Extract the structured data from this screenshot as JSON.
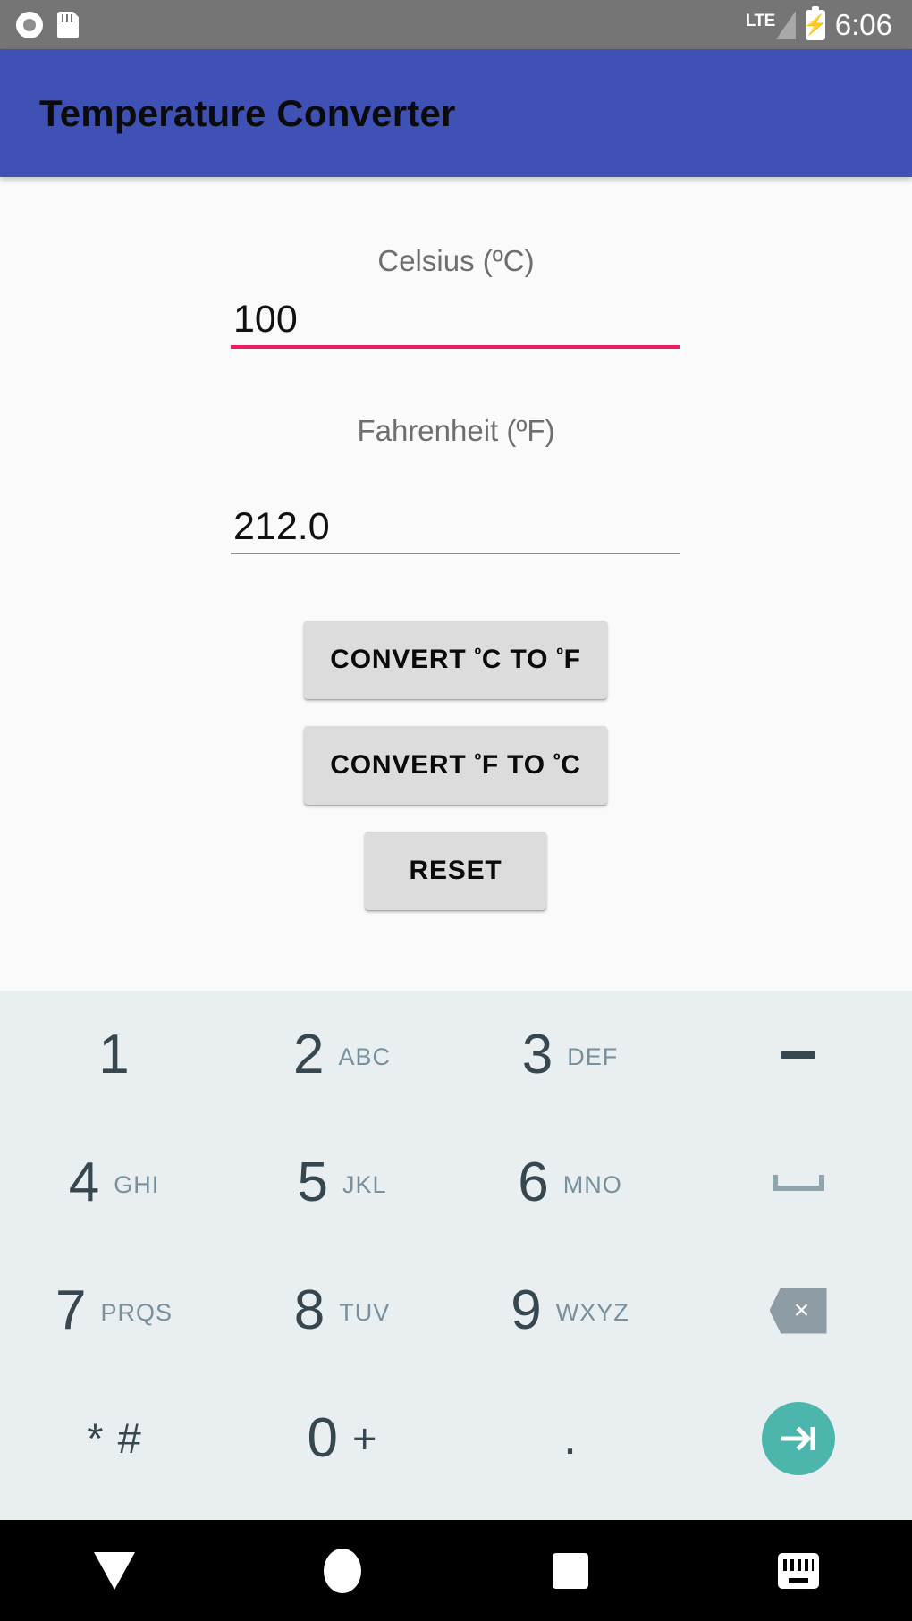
{
  "status_bar": {
    "icons": [
      "screen-record-icon",
      "sd-card-icon"
    ],
    "network": "LTE",
    "battery_state": "charging",
    "time": "6:06",
    "background_color": "#757575"
  },
  "app_bar": {
    "title": "Temperature Converter",
    "background_color": "#3F51B5"
  },
  "form": {
    "celsius": {
      "label": "Celsius (ºC)",
      "value": "100",
      "focused": true,
      "underline_color": "#E91E63"
    },
    "fahrenheit": {
      "label": "Fahrenheit (ºF)",
      "value": "212.0",
      "focused": false,
      "underline_color": "#8C8C8C"
    }
  },
  "buttons": {
    "c_to_f": {
      "prefix": "CONVERT ",
      "deg1": "º",
      "mid1": "C TO ",
      "deg2": "º",
      "mid2": "F"
    },
    "f_to_c": {
      "prefix": "CONVERT ",
      "deg1": "º",
      "mid1": "F TO ",
      "deg2": "º",
      "mid2": "C"
    },
    "reset": "RESET"
  },
  "keyboard": {
    "background_color": "#E9EEF1",
    "digit_color": "#37474F",
    "sub_color": "#78909C",
    "action_color": "#4DB6AC",
    "rows": [
      [
        {
          "digit": "1",
          "sub": "",
          "type": "digit"
        },
        {
          "digit": "2",
          "sub": "ABC",
          "type": "digit"
        },
        {
          "digit": "3",
          "sub": "DEF",
          "type": "digit"
        },
        {
          "digit": "",
          "sub": "",
          "type": "minus"
        }
      ],
      [
        {
          "digit": "4",
          "sub": "GHI",
          "type": "digit"
        },
        {
          "digit": "5",
          "sub": "JKL",
          "type": "digit"
        },
        {
          "digit": "6",
          "sub": "MNO",
          "type": "digit"
        },
        {
          "digit": "",
          "sub": "",
          "type": "space"
        }
      ],
      [
        {
          "digit": "7",
          "sub": "PRQS",
          "type": "digit"
        },
        {
          "digit": "8",
          "sub": "TUV",
          "type": "digit"
        },
        {
          "digit": "9",
          "sub": "WXYZ",
          "type": "digit"
        },
        {
          "digit": "×",
          "sub": "",
          "type": "backspace"
        }
      ],
      [
        {
          "digit": "*",
          "sub": "#",
          "type": "symbols"
        },
        {
          "digit": "0",
          "sub": "+",
          "type": "zero"
        },
        {
          "digit": ".",
          "sub": "",
          "type": "dot"
        },
        {
          "digit": "",
          "sub": "",
          "type": "enter"
        }
      ]
    ]
  },
  "nav_bar": {
    "back": "back-triangle-icon",
    "home": "home-circle-icon",
    "recents": "recents-square-icon",
    "keyboard_switch": "keyboard-switch-icon"
  }
}
